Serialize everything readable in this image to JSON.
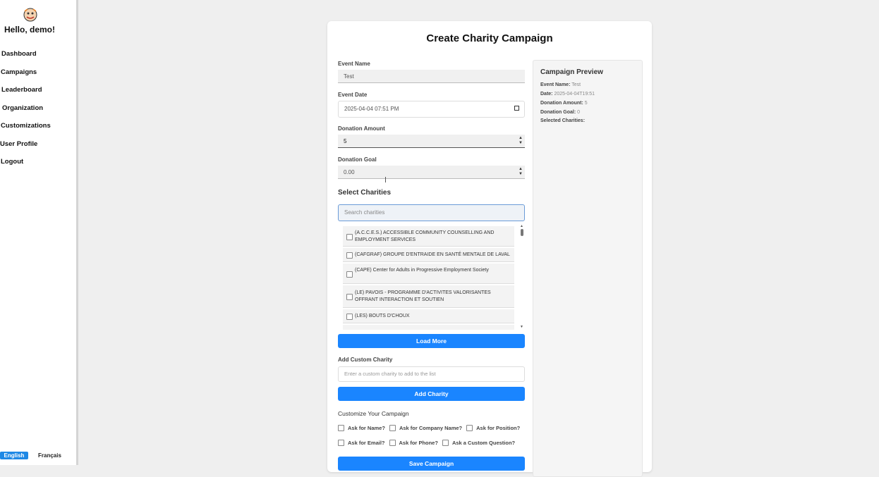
{
  "sidebar": {
    "greeting": "Hello, demo!",
    "nav": [
      "Dashboard",
      "Campaigns",
      "Leaderboard",
      "Organization",
      "Customizations",
      "User Profile",
      "Logout"
    ],
    "languages": [
      "English",
      "Français"
    ]
  },
  "form": {
    "title": "Create Charity Campaign",
    "event_name_label": "Event Name",
    "event_name_value": "Test",
    "event_date_label": "Event Date",
    "event_date_value": "2025-04-04 07:51 PM",
    "donation_amount_label": "Donation Amount",
    "donation_amount_value": "5",
    "donation_goal_label": "Donation Goal",
    "donation_goal_value": "0.00",
    "select_charities_title": "Select Charities",
    "search_placeholder": "Search charities",
    "charities": [
      "(A.C.C.E.S.) ACCESSIBLE COMMUNITY COUNSELLING AND EMPLOYMENT SERVICES",
      "(CAFGRAF) GROUPE D'ENTRAIDE EN SANTÉ MENTALE DE LAVAL",
      "(CAPE) Center for Adults in Progressive Employment Society",
      "(LE) PAVOIS - PROGRAMME D'ACTIVITES VALORISANTES OFFRANT INTERACTION ET SOUTIEN",
      "(LES) BOUTS D'CHOUX"
    ],
    "load_more": "Load More",
    "add_custom_label": "Add Custom Charity",
    "custom_placeholder": "Enter a custom charity to add to the list",
    "add_charity": "Add Charity",
    "customize_title": "Customize Your Campaign",
    "options": [
      "Ask for Name?",
      "Ask for Company Name?",
      "Ask for Position?",
      "Ask for Email?",
      "Ask for Phone?",
      "Ask a Custom Question?"
    ],
    "save": "Save Campaign"
  },
  "preview": {
    "title": "Campaign Preview",
    "event_name_label": "Event Name:",
    "event_name_value": "Test",
    "date_label": "Date:",
    "date_value": "2025-04-04T19:51",
    "amount_label": "Donation Amount:",
    "amount_value": "5",
    "goal_label": "Donation Goal:",
    "goal_value": "0",
    "selected_label": "Selected Charities:"
  },
  "colors": {
    "accent": "#1a85ff",
    "background": "#efefef"
  }
}
